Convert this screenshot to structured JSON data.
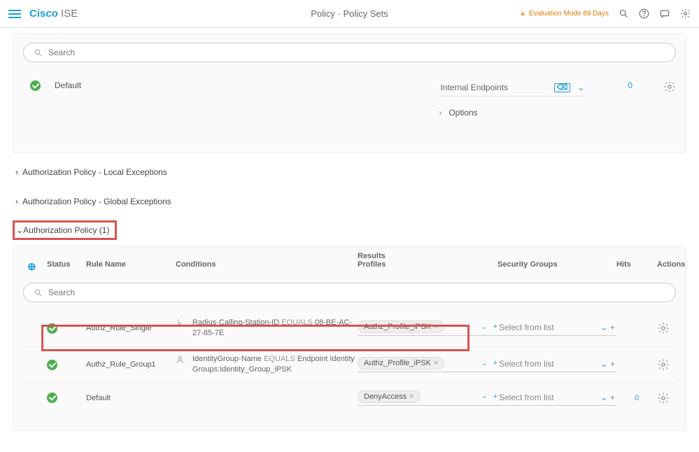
{
  "header": {
    "brand_main": "Cisco",
    "brand_sub": "ISE",
    "crumb": "Policy · Policy Sets",
    "eval_text": "Evaluation Mode 89 Days"
  },
  "search_placeholder": "Search",
  "default_rule": {
    "name": "Default",
    "dropdown": "Internal Endpoints",
    "options": "Options",
    "hits": "0"
  },
  "sections": {
    "local": "Authorization Policy - Local Exceptions",
    "global": "Authorization Policy - Global Exceptions",
    "main": "Authorization Policy (1)"
  },
  "columns": {
    "results": "Results",
    "status": "Status",
    "rule": "Rule Name",
    "cond": "Conditions",
    "profiles": "Profiles",
    "secgroups": "Security Groups",
    "hits": "Hits",
    "actions": "Actions"
  },
  "select_from_list": "Select from list",
  "rules": [
    {
      "name": "Authz_Rule_Single",
      "cond_attr": "Radius·Calling-Station-ID",
      "cond_op": "EQUALS",
      "cond_val": "08-BE-AC-27-85-7E",
      "profile": "Authz_Profile_iPSK",
      "hits": ""
    },
    {
      "name": "Authz_Rule_Group1",
      "cond_attr": "IdentityGroup·Name",
      "cond_op": "EQUALS",
      "cond_val": "Endpoint Identity Groups:Identity_Group_iPSK",
      "profile": "Authz_Profile_iPSK",
      "hits": ""
    },
    {
      "name": "Default",
      "cond_attr": "",
      "cond_op": "",
      "cond_val": "",
      "profile": "DenyAccess",
      "hits": "0"
    }
  ]
}
